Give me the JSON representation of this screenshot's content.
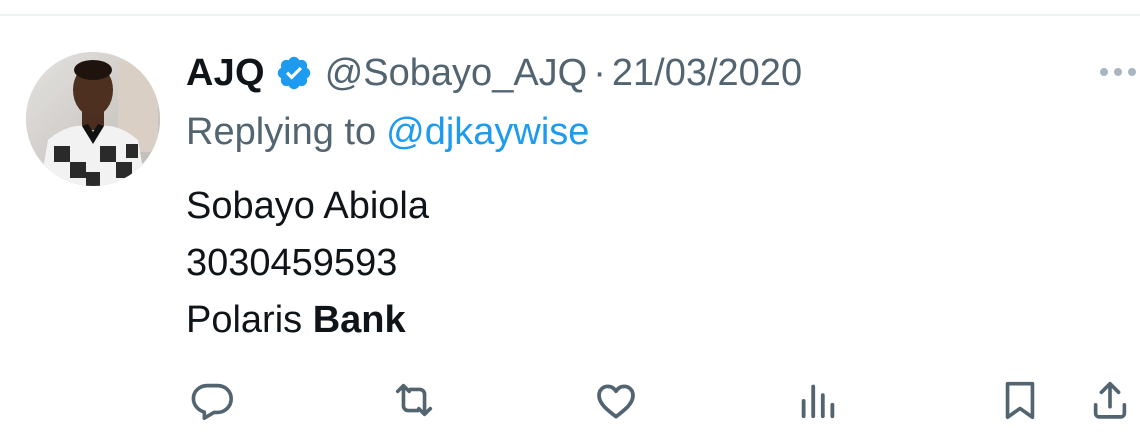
{
  "tweet": {
    "author": {
      "display_name": "AJQ",
      "handle": "@Sobayo_AJQ",
      "verified": true,
      "avatar": "profile-photo"
    },
    "separator": "·",
    "date": "21/03/2020",
    "reply": {
      "prefix": "Replying to",
      "handle": "@djkaywise"
    },
    "text_lines": {
      "line1": "Sobayo Abiola",
      "line2": "3030459593",
      "line3_regular": "Polaris",
      "line3_bold": "Bank"
    }
  },
  "actions": {
    "icons": [
      "reply-icon",
      "retweet-icon",
      "like-icon",
      "views-icon",
      "bookmark-icon",
      "share-icon"
    ]
  },
  "colors": {
    "text_primary": "#0f1419",
    "text_secondary": "#536471",
    "link": "#1d9bf0",
    "verified": "#1d9bf0",
    "divider": "#eff3f4"
  }
}
